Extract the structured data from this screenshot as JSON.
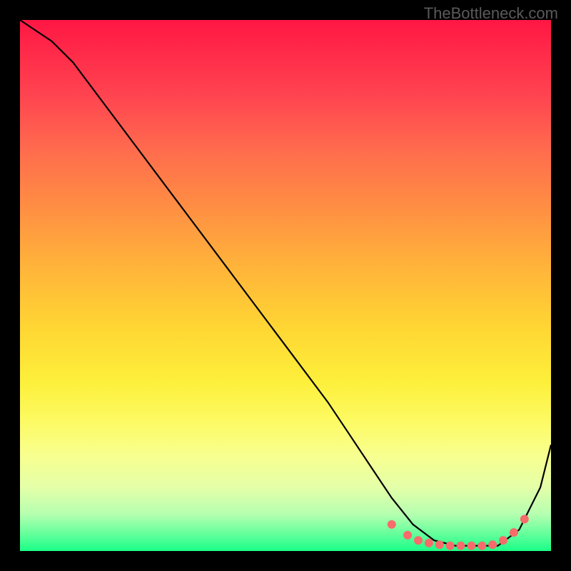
{
  "attribution": "TheBottleneck.com",
  "chart_data": {
    "type": "line",
    "title": "",
    "xlabel": "",
    "ylabel": "",
    "xlim": [
      0,
      100
    ],
    "ylim": [
      0,
      100
    ],
    "series": [
      {
        "name": "bottleneck-curve",
        "x": [
          0,
          6,
          10,
          16,
          22,
          28,
          34,
          40,
          46,
          52,
          58,
          62,
          66,
          70,
          74,
          78,
          82,
          86,
          90,
          94,
          98,
          100
        ],
        "y": [
          100,
          96,
          92,
          84,
          76,
          68,
          60,
          52,
          44,
          36,
          28,
          22,
          16,
          10,
          5,
          2,
          1,
          1,
          1,
          4,
          12,
          20
        ]
      }
    ],
    "markers": {
      "name": "highlight-points",
      "x": [
        70,
        73,
        75,
        77,
        79,
        81,
        83,
        85,
        87,
        89,
        91,
        93,
        95
      ],
      "y": [
        5,
        3,
        2,
        1.5,
        1.2,
        1,
        1,
        1,
        1,
        1.2,
        2,
        3.5,
        6
      ]
    },
    "colors": {
      "curve": "#000000",
      "marker": "#f76b6b"
    }
  }
}
